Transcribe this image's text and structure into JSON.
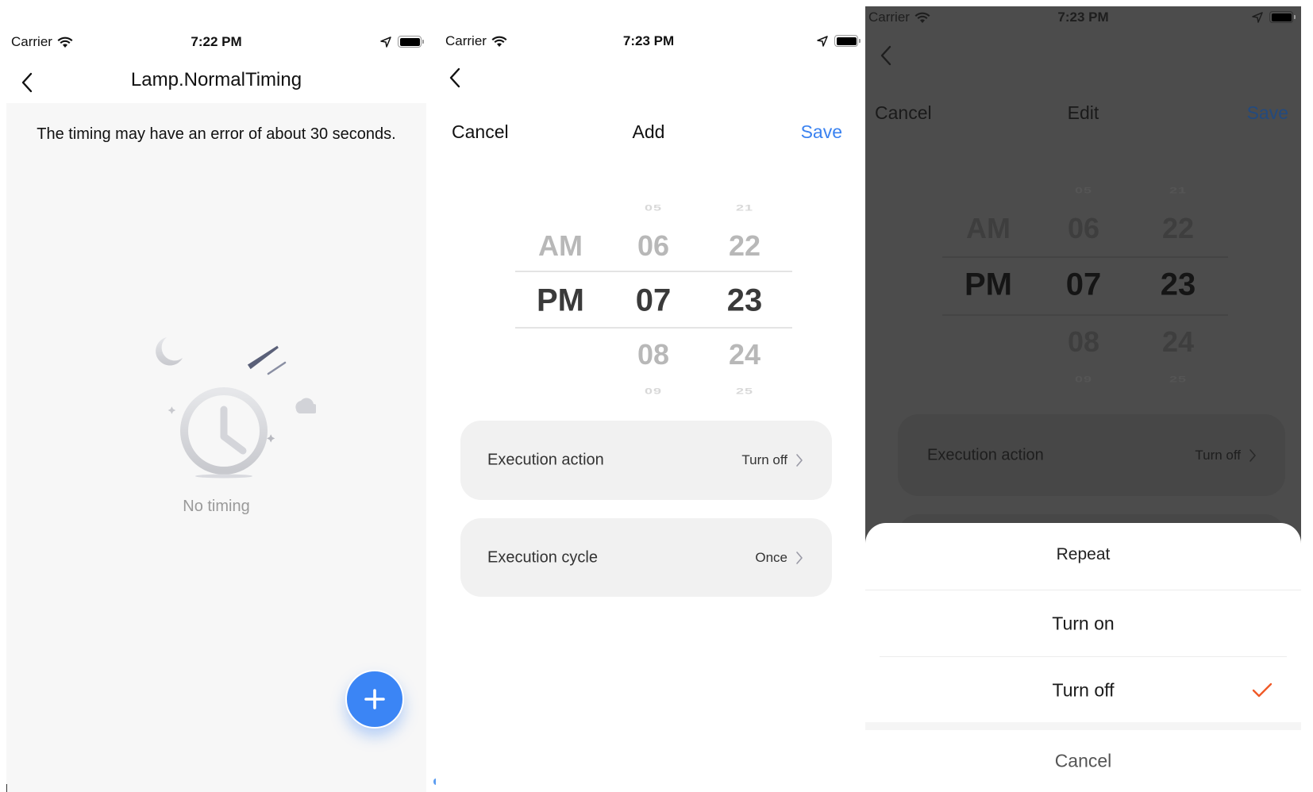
{
  "screens": [
    {
      "status": {
        "carrier": "Carrier",
        "time": "7:22 PM"
      },
      "nav": {
        "title": "Lamp.NormalTiming"
      },
      "notice": "The timing may have an error of about 30 seconds.",
      "empty_state": {
        "icon": "clock-illustration-icon",
        "text": "No timing"
      },
      "fab": {
        "icon": "plus-icon",
        "color": "#3b85f5"
      }
    },
    {
      "status": {
        "carrier": "Carrier",
        "time": "7:23 PM"
      },
      "header": {
        "cancel": "Cancel",
        "title": "Add",
        "save": "Save",
        "save_color": "#3a82f0"
      },
      "picker": {
        "period": {
          "items": [
            "AM",
            "PM"
          ],
          "selected": "PM"
        },
        "hour": {
          "items": [
            "05",
            "06",
            "07",
            "08",
            "09"
          ],
          "selected": "07"
        },
        "minute": {
          "items": [
            "21",
            "22",
            "23",
            "24",
            "25"
          ],
          "selected": "23"
        }
      },
      "settings": [
        {
          "label": "Execution action",
          "value": "Turn off"
        },
        {
          "label": "Execution cycle",
          "value": "Once"
        }
      ]
    },
    {
      "status": {
        "carrier": "Carrier",
        "time": "7:23 PM"
      },
      "header": {
        "cancel": "Cancel",
        "title": "Edit",
        "save": "Save"
      },
      "picker": {
        "period": {
          "items": [
            "AM",
            "PM"
          ],
          "selected": "PM"
        },
        "hour": {
          "items": [
            "05",
            "06",
            "07",
            "08",
            "09"
          ],
          "selected": "07"
        },
        "minute": {
          "items": [
            "21",
            "22",
            "23",
            "24",
            "25"
          ],
          "selected": "23"
        }
      },
      "settings": [
        {
          "label": "Execution action",
          "value": "Turn off"
        }
      ],
      "action_sheet": {
        "title": "Repeat",
        "options": [
          {
            "label": "Turn on",
            "selected": false
          },
          {
            "label": "Turn off",
            "selected": true
          }
        ],
        "cancel": "Cancel",
        "check_color": "#f05a28"
      }
    }
  ]
}
